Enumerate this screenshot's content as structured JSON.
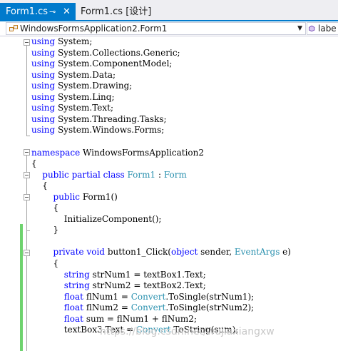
{
  "tabs": {
    "active": {
      "label": "Form1.cs",
      "pin_glyph": "⊸",
      "close_glyph": "✕"
    },
    "inactive": {
      "label": "Form1.cs [设计]"
    }
  },
  "nav": {
    "class_selector": "WindowsFormsApplication2.Form1",
    "member_selector": "labe"
  },
  "code": [
    [
      {
        "t": "using",
        "c": "kw"
      },
      {
        "t": " System;"
      }
    ],
    [
      {
        "t": "using",
        "c": "kw"
      },
      {
        "t": " System.Collections.Generic;"
      }
    ],
    [
      {
        "t": "using",
        "c": "kw"
      },
      {
        "t": " System.ComponentModel;"
      }
    ],
    [
      {
        "t": "using",
        "c": "kw"
      },
      {
        "t": " System.Data;"
      }
    ],
    [
      {
        "t": "using",
        "c": "kw"
      },
      {
        "t": " System.Drawing;"
      }
    ],
    [
      {
        "t": "using",
        "c": "kw"
      },
      {
        "t": " System.Linq;"
      }
    ],
    [
      {
        "t": "using",
        "c": "kw"
      },
      {
        "t": " System.Text;"
      }
    ],
    [
      {
        "t": "using",
        "c": "kw"
      },
      {
        "t": " System.Threading.Tasks;"
      }
    ],
    [
      {
        "t": "using",
        "c": "kw"
      },
      {
        "t": " System.Windows.Forms;"
      }
    ],
    [],
    [
      {
        "t": "namespace",
        "c": "kw"
      },
      {
        "t": " WindowsFormsApplication2"
      }
    ],
    [
      {
        "t": "{"
      }
    ],
    [
      {
        "t": "    "
      },
      {
        "t": "public",
        "c": "kw"
      },
      {
        "t": " "
      },
      {
        "t": "partial",
        "c": "kw"
      },
      {
        "t": " "
      },
      {
        "t": "class",
        "c": "kw"
      },
      {
        "t": " "
      },
      {
        "t": "Form1",
        "c": "ty"
      },
      {
        "t": " : "
      },
      {
        "t": "Form",
        "c": "ty"
      }
    ],
    [
      {
        "t": "    {"
      }
    ],
    [
      {
        "t": "        "
      },
      {
        "t": "public",
        "c": "kw"
      },
      {
        "t": " Form1()"
      }
    ],
    [
      {
        "t": "        {"
      }
    ],
    [
      {
        "t": "            InitializeComponent();"
      }
    ],
    [
      {
        "t": "        }"
      }
    ],
    [],
    [
      {
        "t": "        "
      },
      {
        "t": "private",
        "c": "kw"
      },
      {
        "t": " "
      },
      {
        "t": "void",
        "c": "kw"
      },
      {
        "t": " button1_Click("
      },
      {
        "t": "object",
        "c": "kw"
      },
      {
        "t": " sender, "
      },
      {
        "t": "EventArgs",
        "c": "ty"
      },
      {
        "t": " e)"
      }
    ],
    [
      {
        "t": "        {"
      }
    ],
    [
      {
        "t": "            "
      },
      {
        "t": "string",
        "c": "kw"
      },
      {
        "t": " strNum1 = textBox1.Text;"
      }
    ],
    [
      {
        "t": "            "
      },
      {
        "t": "string",
        "c": "kw"
      },
      {
        "t": " strNum2 = textBox2.Text;"
      }
    ],
    [
      {
        "t": "            "
      },
      {
        "t": "float",
        "c": "kw"
      },
      {
        "t": " flNum1 = "
      },
      {
        "t": "Convert",
        "c": "ty"
      },
      {
        "t": ".ToSingle(strNum1);"
      }
    ],
    [
      {
        "t": "            "
      },
      {
        "t": "float",
        "c": "kw"
      },
      {
        "t": " flNum2 = "
      },
      {
        "t": "Convert",
        "c": "ty"
      },
      {
        "t": ".ToSingle(strNum2);"
      }
    ],
    [
      {
        "t": "            "
      },
      {
        "t": "float",
        "c": "kw"
      },
      {
        "t": " sum = flNum1 + flNum2;"
      }
    ],
    [
      {
        "t": "            textBox3.Text = "
      },
      {
        "t": "Convert",
        "c": "ty"
      },
      {
        "t": ".ToString(sum);"
      }
    ]
  ],
  "watermark": "https://blog.csdn.net/wujiaxiangxw"
}
